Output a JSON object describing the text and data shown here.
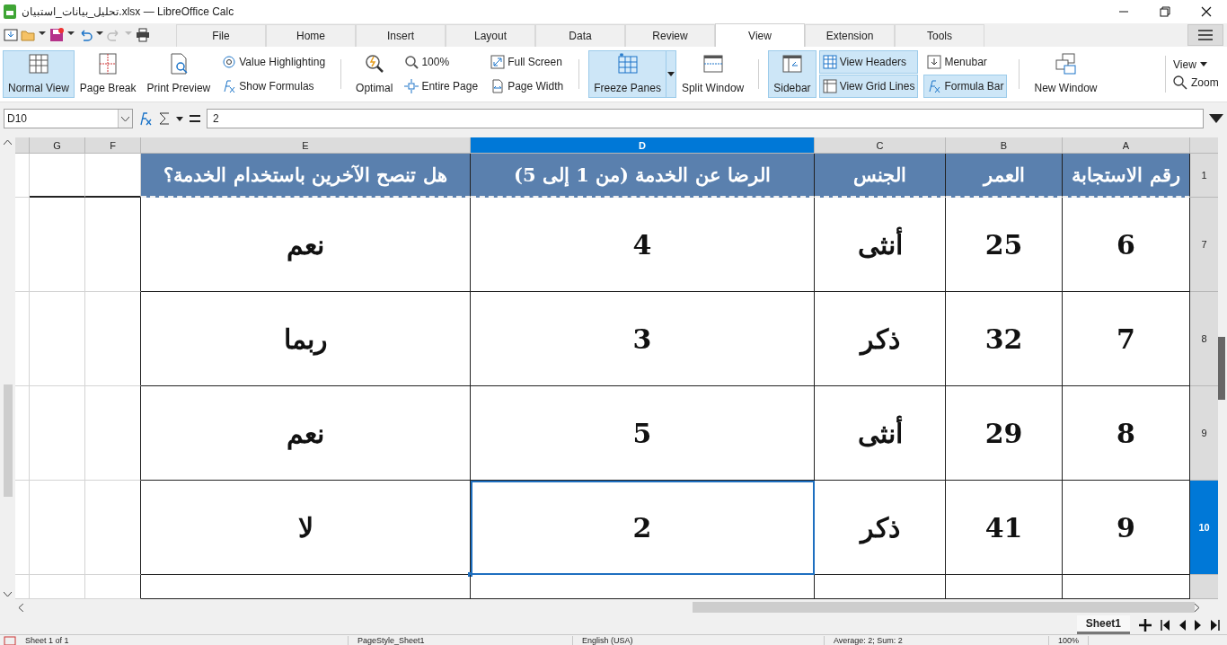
{
  "window": {
    "title": "تحليل_بيانات_استبيان.xlsx — LibreOffice Calc"
  },
  "menu_tabs": [
    {
      "label": "File",
      "selected": false
    },
    {
      "label": "Home",
      "selected": false
    },
    {
      "label": "Insert",
      "selected": false
    },
    {
      "label": "Layout",
      "selected": false
    },
    {
      "label": "Data",
      "selected": false
    },
    {
      "label": "Review",
      "selected": false
    },
    {
      "label": "View",
      "selected": true
    },
    {
      "label": "Extension",
      "selected": false
    },
    {
      "label": "Tools",
      "selected": false
    }
  ],
  "ribbon": [
    {
      "kind": "large",
      "label": "Normal View",
      "on": true
    },
    {
      "kind": "large",
      "label": "Page Break",
      "on": false
    },
    {
      "kind": "large",
      "label": "Print Preview",
      "on": false
    },
    {
      "kind": "pair",
      "items": [
        {
          "label": "Value Highlighting",
          "on": false
        },
        {
          "label": "Show Formulas",
          "on": false
        }
      ]
    },
    {
      "kind": "separator"
    },
    {
      "kind": "large",
      "label": "Optimal",
      "on": false
    },
    {
      "kind": "pair",
      "items": [
        {
          "label": "100%",
          "on": false
        },
        {
          "label": "Entire Page",
          "on": false
        }
      ]
    },
    {
      "kind": "pair",
      "items": [
        {
          "label": "Full Screen",
          "on": false
        },
        {
          "label": "Page Width",
          "on": false
        }
      ]
    },
    {
      "kind": "separator"
    },
    {
      "kind": "split",
      "label": "Freeze Panes",
      "on": true
    },
    {
      "kind": "large",
      "label": "Split Window",
      "on": false
    },
    {
      "kind": "separator"
    },
    {
      "kind": "large",
      "label": "Sidebar",
      "on": true
    },
    {
      "kind": "pair",
      "items": [
        {
          "label": "View Headers",
          "on": true
        },
        {
          "label": "View Grid Lines",
          "on": true
        }
      ]
    },
    {
      "kind": "pair",
      "items": [
        {
          "label": "Menubar",
          "on": false
        },
        {
          "label": "Formula Bar",
          "on": true
        }
      ]
    },
    {
      "kind": "separator"
    },
    {
      "kind": "large",
      "label": "New Window",
      "on": false
    }
  ],
  "ribbon_right": {
    "view_menu": "View",
    "zoom": "Zoom"
  },
  "formula_bar": {
    "cell_ref": "D10",
    "value": "2"
  },
  "sheet": {
    "columns": [
      {
        "label": "G",
        "selected": false
      },
      {
        "label": "F",
        "selected": false
      },
      {
        "label": "E",
        "selected": false
      },
      {
        "label": "D",
        "selected": true
      },
      {
        "label": "C",
        "selected": false
      },
      {
        "label": "B",
        "selected": false
      },
      {
        "label": "A",
        "selected": false
      }
    ],
    "header_row": {
      "row": "1",
      "cells": [
        "رقم الاستجابة",
        "العمر",
        "الجنس",
        "الرضا عن الخدمة (من 1 إلى 5)",
        "هل تنصح الآخرين باستخدام الخدمة؟"
      ]
    },
    "rows": [
      {
        "row": "7",
        "selected": false,
        "cells": [
          {
            "text": "",
            "selected": false
          },
          {
            "text": "",
            "selected": false
          },
          {
            "text": "نعم",
            "selected": false
          },
          {
            "text": "4",
            "selected": false
          },
          {
            "text": "أنثى",
            "selected": false
          },
          {
            "text": "25",
            "selected": false
          },
          {
            "text": "6",
            "selected": false
          }
        ]
      },
      {
        "row": "8",
        "selected": false,
        "cells": [
          {
            "text": "",
            "selected": false
          },
          {
            "text": "",
            "selected": false
          },
          {
            "text": "ربما",
            "selected": false
          },
          {
            "text": "3",
            "selected": false
          },
          {
            "text": "ذكر",
            "selected": false
          },
          {
            "text": "32",
            "selected": false
          },
          {
            "text": "7",
            "selected": false
          }
        ]
      },
      {
        "row": "9",
        "selected": false,
        "cells": [
          {
            "text": "",
            "selected": false
          },
          {
            "text": "",
            "selected": false
          },
          {
            "text": "نعم",
            "selected": false
          },
          {
            "text": "5",
            "selected": false
          },
          {
            "text": "أنثى",
            "selected": false
          },
          {
            "text": "29",
            "selected": false
          },
          {
            "text": "8",
            "selected": false
          }
        ]
      },
      {
        "row": "10",
        "selected": true,
        "cells": [
          {
            "text": "",
            "selected": false
          },
          {
            "text": "",
            "selected": false
          },
          {
            "text": "لا",
            "selected": false
          },
          {
            "text": "2",
            "selected": true
          },
          {
            "text": "ذكر",
            "selected": false
          },
          {
            "text": "41",
            "selected": false
          },
          {
            "text": "9",
            "selected": false
          }
        ]
      }
    ]
  },
  "sheet_tabs": [
    {
      "label": "Sheet1",
      "selected": true
    }
  ],
  "status_bar": [
    "Sheet 1 of 1",
    "PageStyle_Sheet1",
    "English (USA)",
    "Average: 2; Sum: 2",
    "100%"
  ]
}
